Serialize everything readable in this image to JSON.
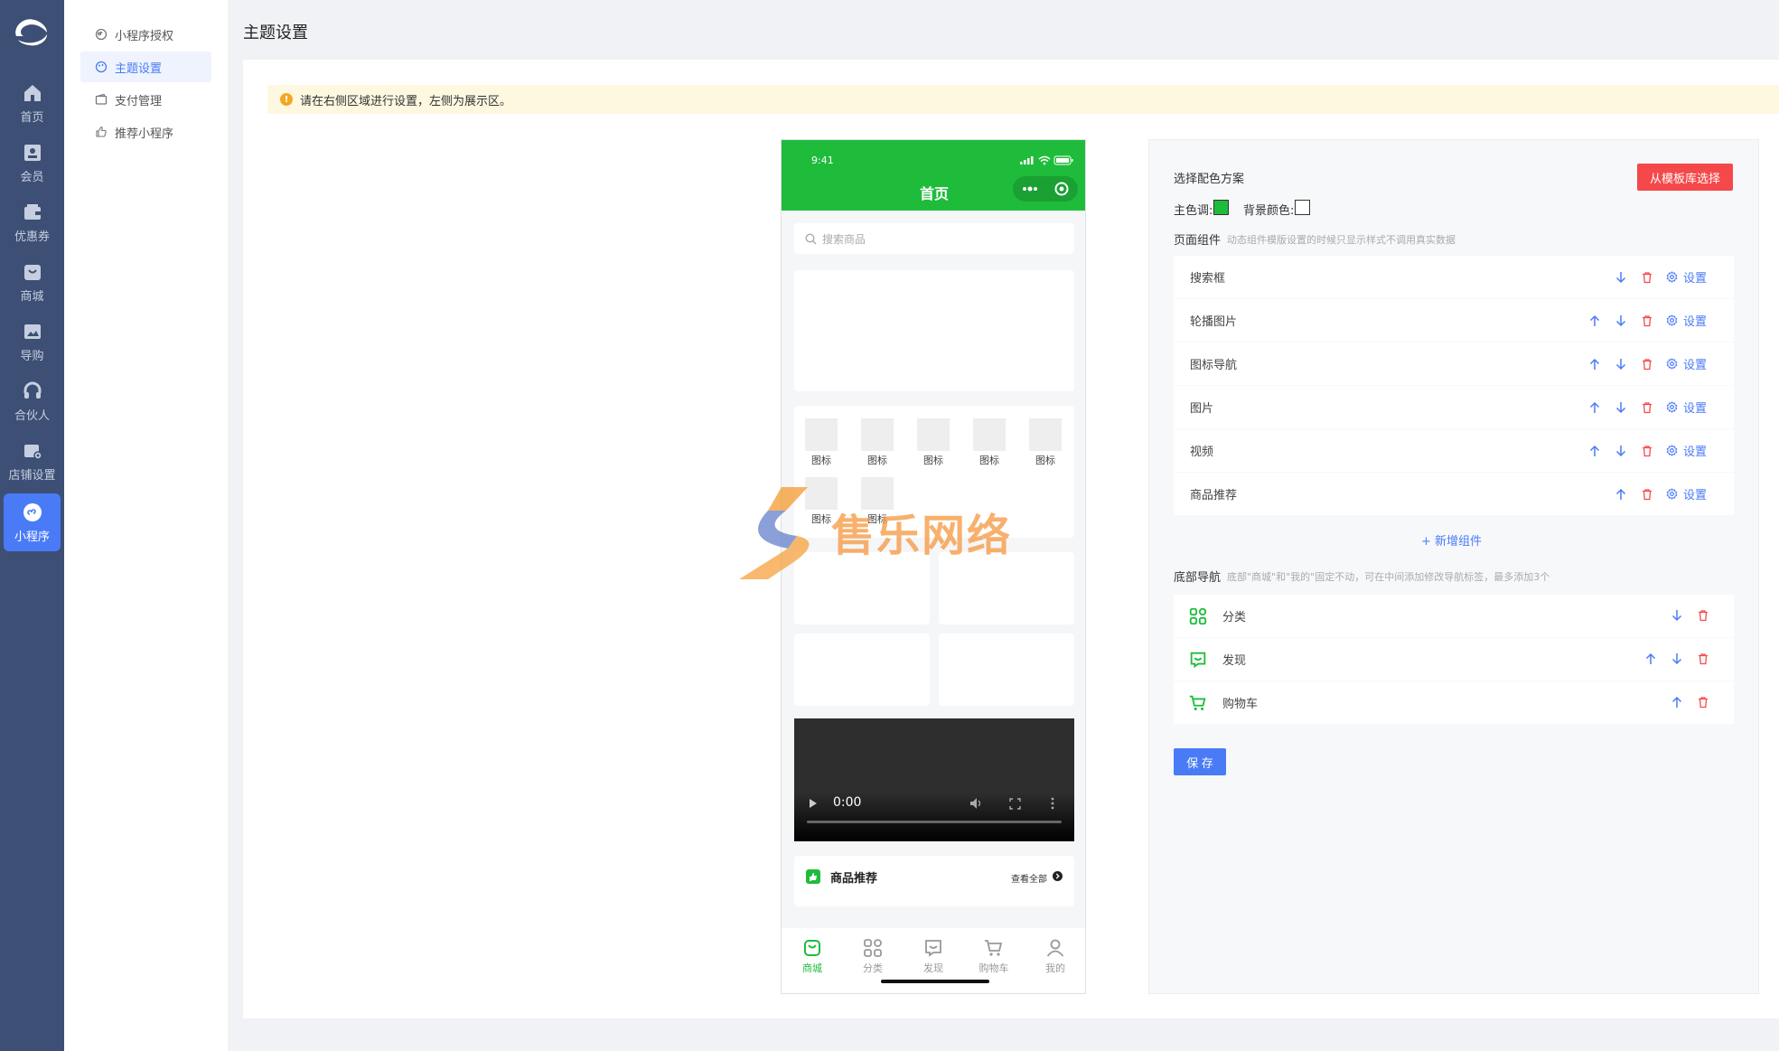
{
  "rail": {
    "items": [
      {
        "label": "首页"
      },
      {
        "label": "会员"
      },
      {
        "label": "优惠券"
      },
      {
        "label": "商城"
      },
      {
        "label": "导购"
      },
      {
        "label": "合伙人"
      },
      {
        "label": "店铺设置"
      },
      {
        "label": "小程序"
      }
    ]
  },
  "submenu": {
    "items": [
      {
        "label": "小程序授权"
      },
      {
        "label": "主题设置"
      },
      {
        "label": "支付管理"
      },
      {
        "label": "推荐小程序"
      }
    ]
  },
  "page": {
    "title": "主题设置",
    "notice": "请在右侧区域进行设置，左侧为展示区。"
  },
  "phone": {
    "time": "9:41",
    "title": "首页",
    "search_placeholder": "搜索商品",
    "icon_label": "图标",
    "video_time": "0:00",
    "rec_title": "商品推荐",
    "rec_more": "查看全部",
    "tabs": [
      {
        "label": "商城"
      },
      {
        "label": "分类"
      },
      {
        "label": "发现"
      },
      {
        "label": "购物车"
      },
      {
        "label": "我的"
      }
    ]
  },
  "watermark": {
    "text": "售乐网络"
  },
  "settings": {
    "scheme_label": "选择配色方案",
    "template_button": "从模板库选择",
    "main_color_label": "主色调:",
    "main_color": "#1fbc3c",
    "bg_color_label": "背景颜色:",
    "bg_color": "#ffffff",
    "components_label": "页面组件",
    "components_hint": "动态组件模版设置的时候只显示样式不调用真实数据",
    "components": [
      {
        "name": "搜索框"
      },
      {
        "name": "轮播图片"
      },
      {
        "name": "图标导航"
      },
      {
        "name": "图片"
      },
      {
        "name": "视频"
      },
      {
        "name": "商品推荐"
      }
    ],
    "set_label": "设置",
    "add_component": "+ 新增组件",
    "nav_label": "底部导航",
    "nav_hint": "底部\"商城\"和\"我的\"固定不动，可在中间添加修改导航标签，最多添加3个",
    "nav_items": [
      {
        "name": "分类"
      },
      {
        "name": "发现"
      },
      {
        "name": "购物车"
      }
    ],
    "save_button": "保 存"
  },
  "colors": {
    "rail_bg": "#3d4f75",
    "accent": "#4a7bf7",
    "brand_green": "#1fbc3c",
    "danger": "#f5484a"
  }
}
